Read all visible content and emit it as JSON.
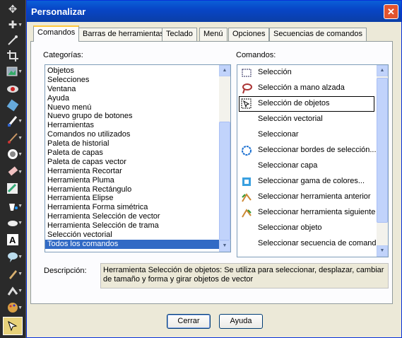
{
  "dialog": {
    "title": "Personalizar",
    "close_symbol": "✕"
  },
  "tabs": [
    {
      "label": "Comandos",
      "active": true
    },
    {
      "label": "Barras de herramientas"
    },
    {
      "label": "Teclado"
    },
    {
      "label": "Menú"
    },
    {
      "label": "Opciones"
    },
    {
      "label": "Secuencias de comandos"
    }
  ],
  "categories": {
    "label": "Categorías:",
    "items": [
      "Objetos",
      "Selecciones",
      "Ventana",
      "Ayuda",
      "Nuevo menú",
      "Nuevo grupo de botones",
      "Herramientas",
      "Comandos no utilizados",
      "Paleta de historial",
      "Paleta de capas",
      "Paleta de capas vector",
      "Herramienta Recortar",
      "Herramienta Pluma",
      "Herramienta Rectángulo",
      "Herramienta Elipse",
      "Herramienta Forma simétrica",
      "Herramienta Selección de vector",
      "Herramienta Selección de trama",
      "Selección vectorial",
      "Todos los comandos"
    ],
    "selected": "Todos los comandos"
  },
  "commands": {
    "label": "Comandos:",
    "items": [
      {
        "label": "Selección",
        "icon": "marquee-selection-icon",
        "submenu": false
      },
      {
        "label": "Selección a mano alzada",
        "icon": "lasso-icon",
        "submenu": false
      },
      {
        "label": "Selección de objetos",
        "icon": "object-selection-icon",
        "submenu": false,
        "boxed": true
      },
      {
        "label": "Selección vectorial",
        "icon": "",
        "submenu": true
      },
      {
        "label": "Seleccionar",
        "icon": "",
        "submenu": false
      },
      {
        "label": "Seleccionar bordes de selección...",
        "icon": "select-borders-icon",
        "submenu": false
      },
      {
        "label": "Seleccionar capa",
        "icon": "",
        "submenu": true
      },
      {
        "label": "Seleccionar gama de colores...",
        "icon": "color-range-icon",
        "submenu": false
      },
      {
        "label": "Seleccionar herramienta anterior",
        "icon": "previous-tool-icon",
        "submenu": false
      },
      {
        "label": "Seleccionar herramienta siguiente",
        "icon": "next-tool-icon",
        "submenu": false
      },
      {
        "label": "Seleccionar objeto",
        "icon": "",
        "submenu": true
      },
      {
        "label": "Seleccionar secuencia de comandos",
        "icon": "",
        "submenu": false
      }
    ]
  },
  "description": {
    "label": "Descripción:",
    "text": "Herramienta Selección de objetos: Se utiliza para seleccionar, desplazar, cambiar de tamaño y forma y girar objetos de vector"
  },
  "buttons": {
    "close": "Cerrar",
    "help": "Ayuda"
  },
  "toolstrip": {
    "tools": [
      "pan-icon",
      "zoom-icon",
      "eyedropper-icon",
      "crop-icon",
      "picture-tube-icon",
      "red-eye-icon",
      "clone-brush-icon",
      "brush-icon",
      "paintbrush-icon",
      "flood-fill-icon",
      "eraser-icon",
      "color-replacer-icon",
      "paint-bucket-icon",
      "retouch-icon",
      "text-icon",
      "shape-icon",
      "pen-icon",
      "warp-brush-icon",
      "art-media-icon",
      "object-selector-icon"
    ]
  },
  "colors": {
    "titlebar": "#0846c7",
    "selection": "#316ac5",
    "dialog_bg": "#ece9d8"
  }
}
